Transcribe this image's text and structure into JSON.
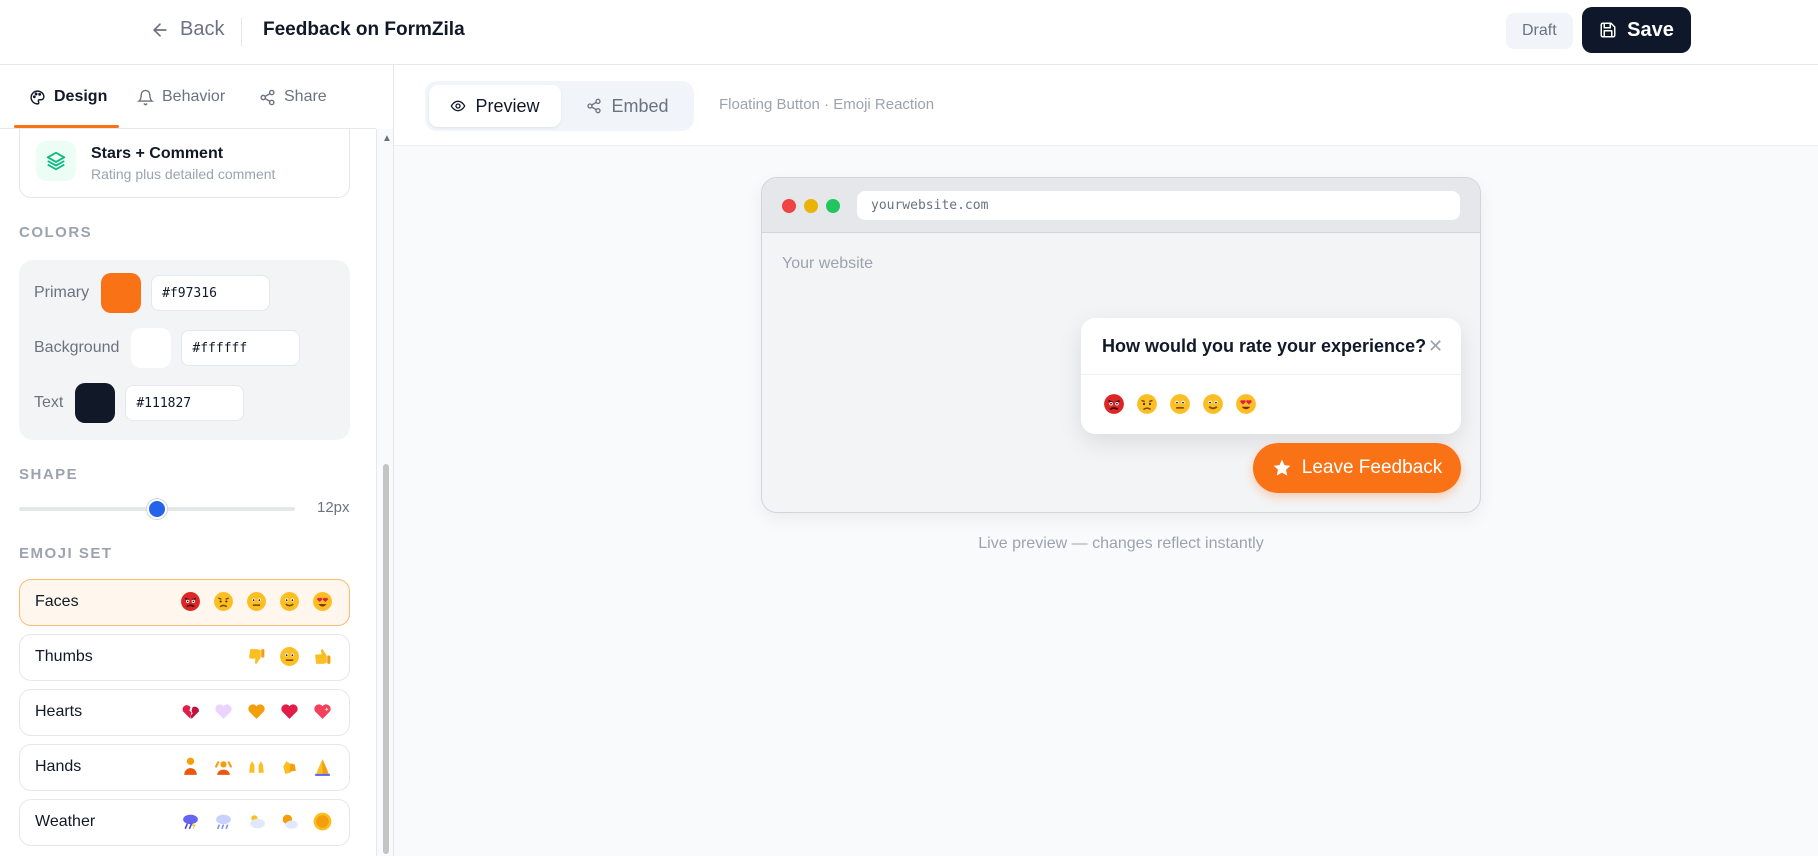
{
  "header": {
    "back_label": "Back",
    "title": "Feedback on FormZila",
    "status_badge": "Draft",
    "save_label": "Save"
  },
  "sidebar": {
    "tabs": [
      {
        "label": "Design",
        "icon": "palette-icon",
        "active": true
      },
      {
        "label": "Behavior",
        "icon": "bell-icon",
        "active": false
      },
      {
        "label": "Share",
        "icon": "share-icon",
        "active": false
      }
    ],
    "widget_style": {
      "name": "Stars + Comment",
      "description": "Rating plus detailed comment",
      "icon": "layers-icon"
    },
    "colors_section": "COLORS",
    "colors": [
      {
        "label": "Primary",
        "value": "#f97316"
      },
      {
        "label": "Background",
        "value": "#ffffff"
      },
      {
        "label": "Text",
        "value": "#111827"
      }
    ],
    "shape_section": "SHAPE",
    "shape_radius": {
      "value": 12,
      "min": 0,
      "max": 24,
      "display": "12px"
    },
    "emoji_section": "EMOJI SET",
    "emoji_sets": [
      {
        "label": "Faces",
        "selected": true,
        "emojis": [
          "angry-face",
          "sad-face",
          "neutral-face",
          "smiling-face",
          "heart-eyes-face"
        ]
      },
      {
        "label": "Thumbs",
        "selected": false,
        "emojis": [
          "thumbs-down",
          "neutral-face",
          "thumbs-up"
        ]
      },
      {
        "label": "Hearts",
        "selected": false,
        "emojis": [
          "broken-heart",
          "white-heart",
          "yellow-heart",
          "red-heart",
          "sparkling-heart"
        ]
      },
      {
        "label": "Hands",
        "selected": false,
        "emojis": [
          "raised-hand",
          "raising-hands-low",
          "raising-hands",
          "clapping-hands",
          "folded-hands"
        ]
      },
      {
        "label": "Weather",
        "selected": false,
        "emojis": [
          "thunder-cloud",
          "rain-cloud",
          "cloud",
          "sun-behind-cloud",
          "sun"
        ]
      }
    ]
  },
  "main": {
    "tabs": [
      {
        "label": "Preview",
        "icon": "eye-icon",
        "active": true
      },
      {
        "label": "Embed",
        "icon": "share-icon",
        "active": false
      }
    ],
    "mode_text": "Floating Button · Emoji Reaction",
    "browser": {
      "url": "yourwebsite.com",
      "site_label": "Your website"
    },
    "popup": {
      "question": "How would you rate your experience?",
      "close_glyph": "✕"
    },
    "fab_label": "Leave Feedback",
    "caption": "Live preview — changes reflect instantly"
  }
}
